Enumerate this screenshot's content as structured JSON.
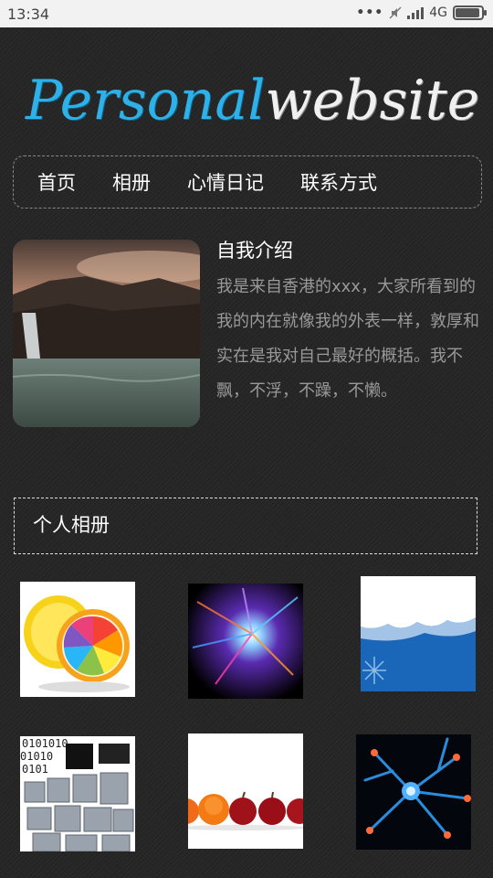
{
  "status": {
    "time": "13:34",
    "network": "4G"
  },
  "logo": {
    "part1": "Personal",
    "part2": "website"
  },
  "nav": [
    {
      "label": "首页"
    },
    {
      "label": "相册"
    },
    {
      "label": "心情日记"
    },
    {
      "label": "联系方式"
    }
  ],
  "intro": {
    "title": "自我介绍",
    "text": "我是来自香港的xxx，大家所看到的我的内在就像我的外表一样，敦厚和实在是我对自己最好的概括。我不飘，不浮，不躁，不懒。"
  },
  "album": {
    "title": "个人相册"
  },
  "icons": {
    "dots": "more-dots-icon",
    "mute": "mute-icon",
    "signal": "signal-icon",
    "battery": "battery-icon"
  },
  "colors": {
    "logo_blue": "#2eb1e8",
    "background": "#262626"
  },
  "battery_level": 0.85
}
